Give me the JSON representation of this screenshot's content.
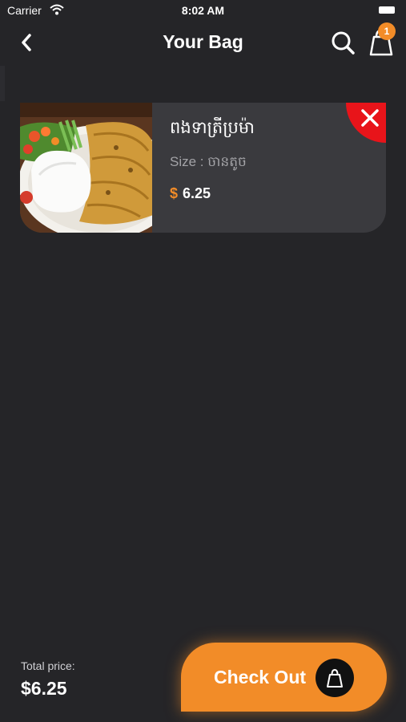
{
  "status_bar": {
    "carrier": "Carrier",
    "time": "8:02 AM"
  },
  "header": {
    "title": "Your Bag",
    "bag_count": "1"
  },
  "cart": {
    "items": [
      {
        "name": "ពងទាត្រីប្រម៉ា",
        "size": "Size : ចានតូច",
        "currency": "$",
        "price": "6.25"
      }
    ]
  },
  "footer": {
    "total_label": "Total price:",
    "total_value": "$6.25",
    "checkout_label": "Check Out"
  },
  "colors": {
    "accent": "#f28c28",
    "background": "#252528",
    "card": "#3a3a3e",
    "remove": "#e8141a"
  },
  "icons": [
    "wifi-icon",
    "battery-icon",
    "chevron-left-icon",
    "search-icon",
    "shopping-bag-icon",
    "close-icon"
  ]
}
